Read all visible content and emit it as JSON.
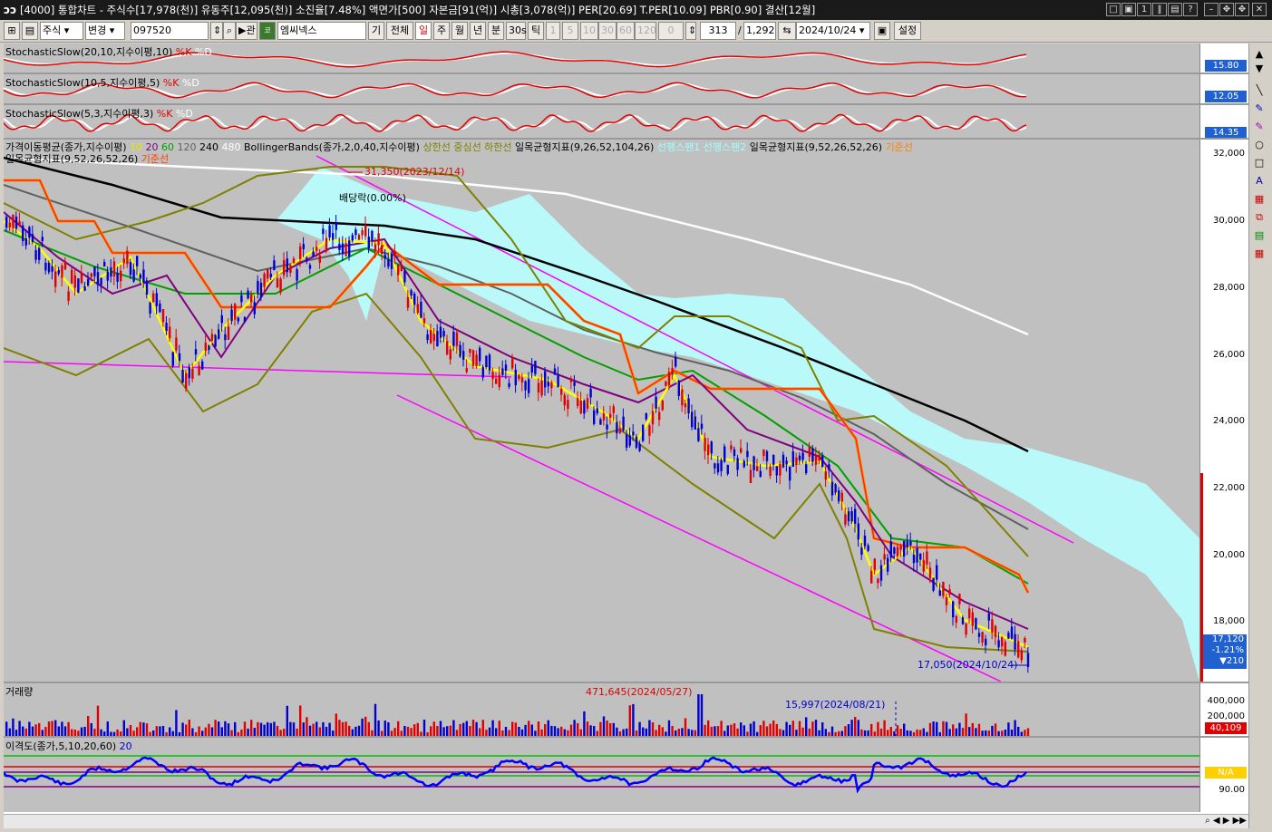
{
  "window": {
    "title": "[4000] 통합차트 - 주식수[17,978(천)] 유동주[12,095(천)] 소진율[7.48%] 액면가[500] 자본금[91(억)] 시총[3,078(억)] PER[20.69] T.PER[10.09] PBR[0.90] 결산[12월]"
  },
  "toolbar": {
    "market": "주식",
    "change_label": "변경",
    "code": "097520",
    "name": "엠씨넥스",
    "btn_ki": "기",
    "btn_all": "전체",
    "btn_il": "일",
    "btn_ju": "주",
    "btn_wol": "월",
    "btn_nyeon": "년",
    "btn_bun": "분",
    "btn_30s": "30s",
    "btn_tik": "틱",
    "periods": [
      "1",
      "5",
      "10",
      "30",
      "60",
      "120"
    ],
    "tick_count": "0",
    "view_count": "313",
    "total_count": "1,292",
    "date": "2024/10/24",
    "settings": "설정"
  },
  "stoch": [
    {
      "label": "StochasticSlow(20,10,지수이평,10)",
      "k": "%K",
      "d": "%D",
      "value": "15.80"
    },
    {
      "label": "StochasticSlow(10,5,지수이평,5)",
      "k": "%K",
      "d": "%D",
      "value": "12.05"
    },
    {
      "label": "StochasticSlow(5,3,지수이평,3)",
      "k": "%K",
      "d": "%D",
      "value": "14.35"
    }
  ],
  "price": {
    "legend1_parts": [
      {
        "t": "가격이동평균(종가,지수이평) ",
        "c": "#000000"
      },
      {
        "t": "10 ",
        "c": "#e6e600"
      },
      {
        "t": "20 ",
        "c": "#800080"
      },
      {
        "t": "60 ",
        "c": "#00a000"
      },
      {
        "t": "120 ",
        "c": "#606060"
      },
      {
        "t": "240 ",
        "c": "#000000"
      },
      {
        "t": "480 ",
        "c": "#ffffff"
      },
      {
        "t": "BollingerBands(종가,2,0,40,지수이평) ",
        "c": "#000000"
      },
      {
        "t": "상한선 중심선 하한선 ",
        "c": "#808000"
      },
      {
        "t": "일목균형지표(9,26,52,104,26) ",
        "c": "#000000"
      },
      {
        "t": "선행스팬1 선행스팬2 ",
        "c": "#a0ffff"
      },
      {
        "t": "일목균형지표(9,52,26,52,26) ",
        "c": "#000000"
      },
      {
        "t": "기준선",
        "c": "#ff8000"
      }
    ],
    "legend2_parts": [
      {
        "t": "일목균형지표(9,52,26,52,26) ",
        "c": "#000000"
      },
      {
        "t": "기준선",
        "c": "#ff4000"
      }
    ],
    "high_label": "31,350(2023/12/14)",
    "low_label": "17,050(2024/10/24)",
    "event_label": "배당락(0.00%)",
    "ticks": [
      "32,000",
      "30,000",
      "28,000",
      "26,000",
      "24,000",
      "22,000",
      "20,000",
      "18,000"
    ],
    "current": "17,120",
    "change": "-1.21%",
    "diff": "▼210"
  },
  "volume": {
    "label": "거래량",
    "peak_label": "471,645(2024/05/27)",
    "mark_label": "15,997(2024/08/21)",
    "ticks": [
      "400,000",
      "200,000"
    ],
    "current": "40,109"
  },
  "disparity": {
    "label": "이격도(종가,5,10,20,60)",
    "extra": "20",
    "value": "N/A",
    "tick": "90.00"
  },
  "colors": {
    "up": "#e00000",
    "down": "#0000d0",
    "bg": "#c0c0c0",
    "cloud": "#b8ffff"
  }
}
